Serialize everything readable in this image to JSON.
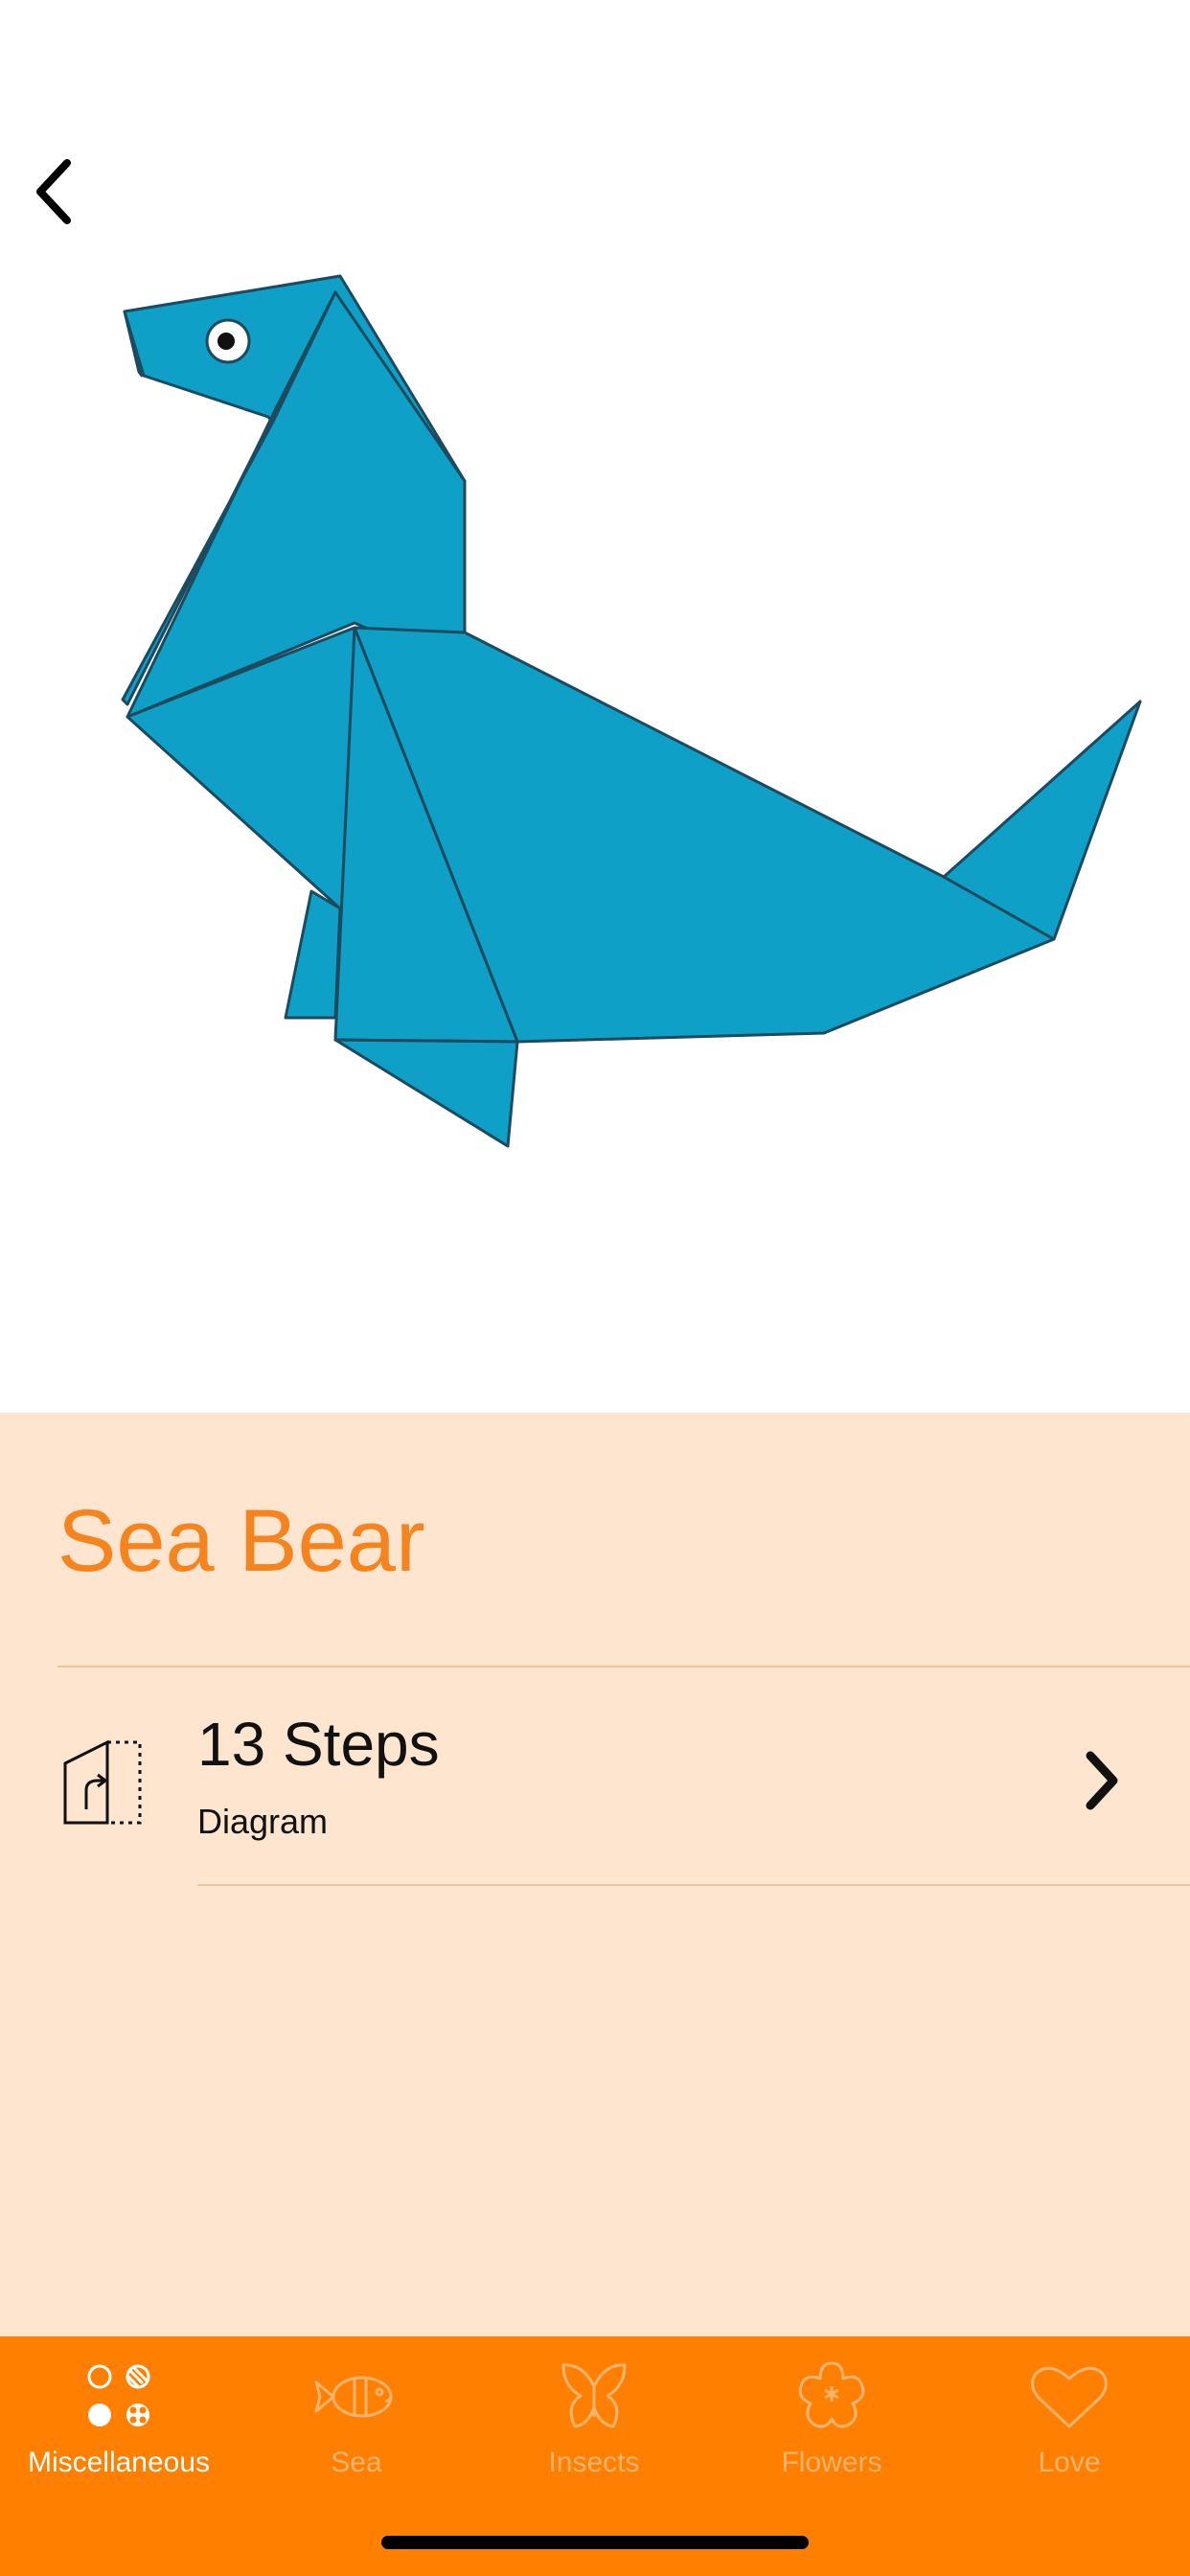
{
  "colors": {
    "accent": "#f5841f",
    "panel_bg": "#fde5cf",
    "tabbar_bg": "#ff8000",
    "tab_active": "#ffffff",
    "tab_inactive": "#f7b46f",
    "origami_blue": "#0fa0c8"
  },
  "nav": {
    "back_icon": "chevron-left-icon"
  },
  "hero": {
    "image": "origami-seal-illustration"
  },
  "model": {
    "title": "Sea Bear"
  },
  "instructions": {
    "icon": "fold-diagram-icon",
    "title": "13 Steps",
    "subtitle": "Diagram",
    "chevron": "chevron-right-icon"
  },
  "tabs": [
    {
      "label": "Miscellaneous",
      "icon": "miscellaneous-icon",
      "active": true
    },
    {
      "label": "Sea",
      "icon": "fish-icon",
      "active": false
    },
    {
      "label": "Insects",
      "icon": "butterfly-icon",
      "active": false
    },
    {
      "label": "Flowers",
      "icon": "flower-icon",
      "active": false
    },
    {
      "label": "Love",
      "icon": "heart-icon",
      "active": false
    }
  ]
}
